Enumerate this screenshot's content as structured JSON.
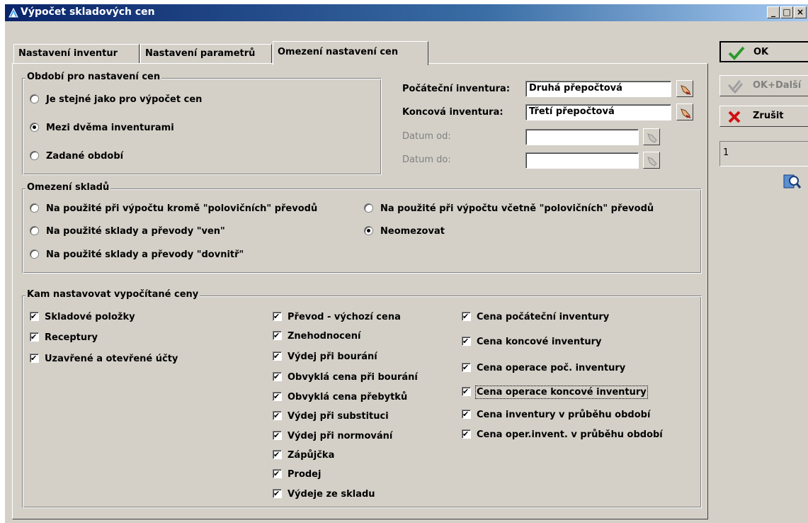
{
  "window": {
    "title": "Výpočet skladových cen"
  },
  "tabs": [
    {
      "label": "Nastavení inventur"
    },
    {
      "label": "Nastavení parametrů"
    },
    {
      "label": "Omezení nastavení cen"
    }
  ],
  "period": {
    "legend": "Období pro nastavení cen",
    "options": [
      "Je stejné jako pro výpočet cen",
      "Mezi dvěma inventurami",
      "Zadané období"
    ],
    "selected": "Mezi dvěma inventurami"
  },
  "inventory_fields": {
    "start_label": "Počáteční inventura:",
    "start_value": "Druhá přepočtová",
    "end_label": "Koncová inventura:",
    "end_value": "Třetí přepočtová",
    "date_from_label": "Datum od:",
    "date_from_value": "",
    "date_to_label": "Datum do:",
    "date_to_value": ""
  },
  "warehouses": {
    "legend": "Omezení skladů",
    "options": [
      "Na použité při výpočtu kromě \"polovičních\" převodů",
      "Na použité při výpočtu včetně \"polovičních\" převodů",
      "Na použité sklady a převody \"ven\"",
      "Neomezovat",
      "Na použité sklady a převody \"dovnitř\""
    ],
    "selected": "Neomezovat"
  },
  "targets": {
    "legend": "Kam nastavovat vypočítané ceny",
    "col1": [
      "Skladové položky",
      "Receptury",
      "Uzavřené a otevřené účty"
    ],
    "col2": [
      "Převod - výchozí cena",
      "Znehodnocení",
      "Výdej při bourání",
      "Obvyklá cena při bourání",
      "Obvyklá cena přebytků",
      "Výdej při substituci",
      "Výdej při normování",
      "Zápůjčka",
      "Prodej",
      "Výdeje ze skladu"
    ],
    "col3": [
      "Cena počáteční inventury",
      "Cena koncové inventury",
      "Cena operace poč. inventury",
      "Cena operace koncové inventury",
      "Cena inventury v průběhu období",
      "Cena oper.invent. v průběhu období"
    ],
    "all_checked": true,
    "focused_item": "Cena operace koncové inventury"
  },
  "side": {
    "ok": "OK",
    "ok_next": "OK+Další",
    "cancel": "Zrušit",
    "counter": "1"
  },
  "icons": {
    "ok": "checkmark-icon",
    "ok_next": "double-checkmark-icon",
    "cancel": "red-x-icon",
    "picker": "pointing-hand-icon",
    "help": "help-search-icon"
  },
  "colors": {
    "titlebar_start": "#0a246a",
    "titlebar_end": "#a6caf0",
    "face": "#d4d0c8",
    "ok_green": "#2a9a2a",
    "cancel_red": "#d01010"
  }
}
